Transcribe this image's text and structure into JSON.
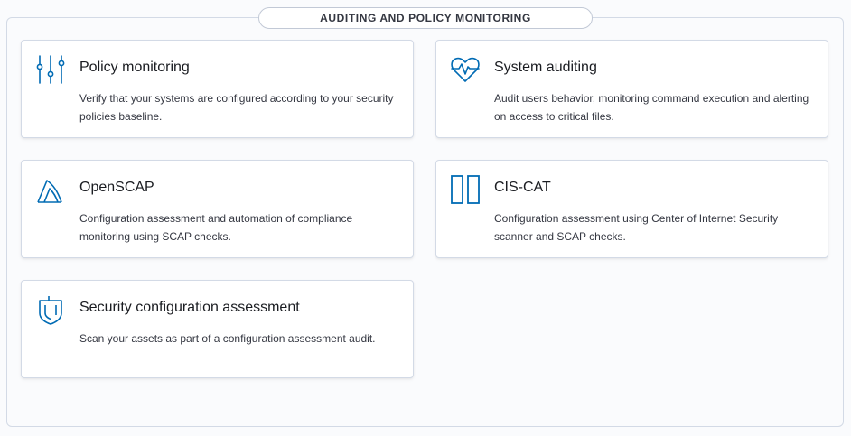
{
  "section": {
    "title": "AUDITING AND POLICY MONITORING"
  },
  "cards": [
    {
      "title": "Policy monitoring",
      "description": "Verify that your systems are configured according to your security policies baseline.",
      "icon": "sliders-icon"
    },
    {
      "title": "System auditing",
      "description": "Audit users behavior, monitoring command execution and alerting on access to critical files.",
      "icon": "heart-pulse-icon"
    },
    {
      "title": "OpenSCAP",
      "description": "Configuration assessment and automation of compliance monitoring using SCAP checks.",
      "icon": "openscap-logo-icon"
    },
    {
      "title": "CIS-CAT",
      "description": "Configuration assessment using Center of Internet Security scanner and SCAP checks.",
      "icon": "columns-icon"
    },
    {
      "title": "Security configuration assessment",
      "description": "Scan your assets as part of a configuration assessment audit.",
      "icon": "shield-icon"
    }
  ],
  "colors": {
    "icon": "#006bb4",
    "border": "#d3dae6",
    "background": "#fafbfd"
  }
}
